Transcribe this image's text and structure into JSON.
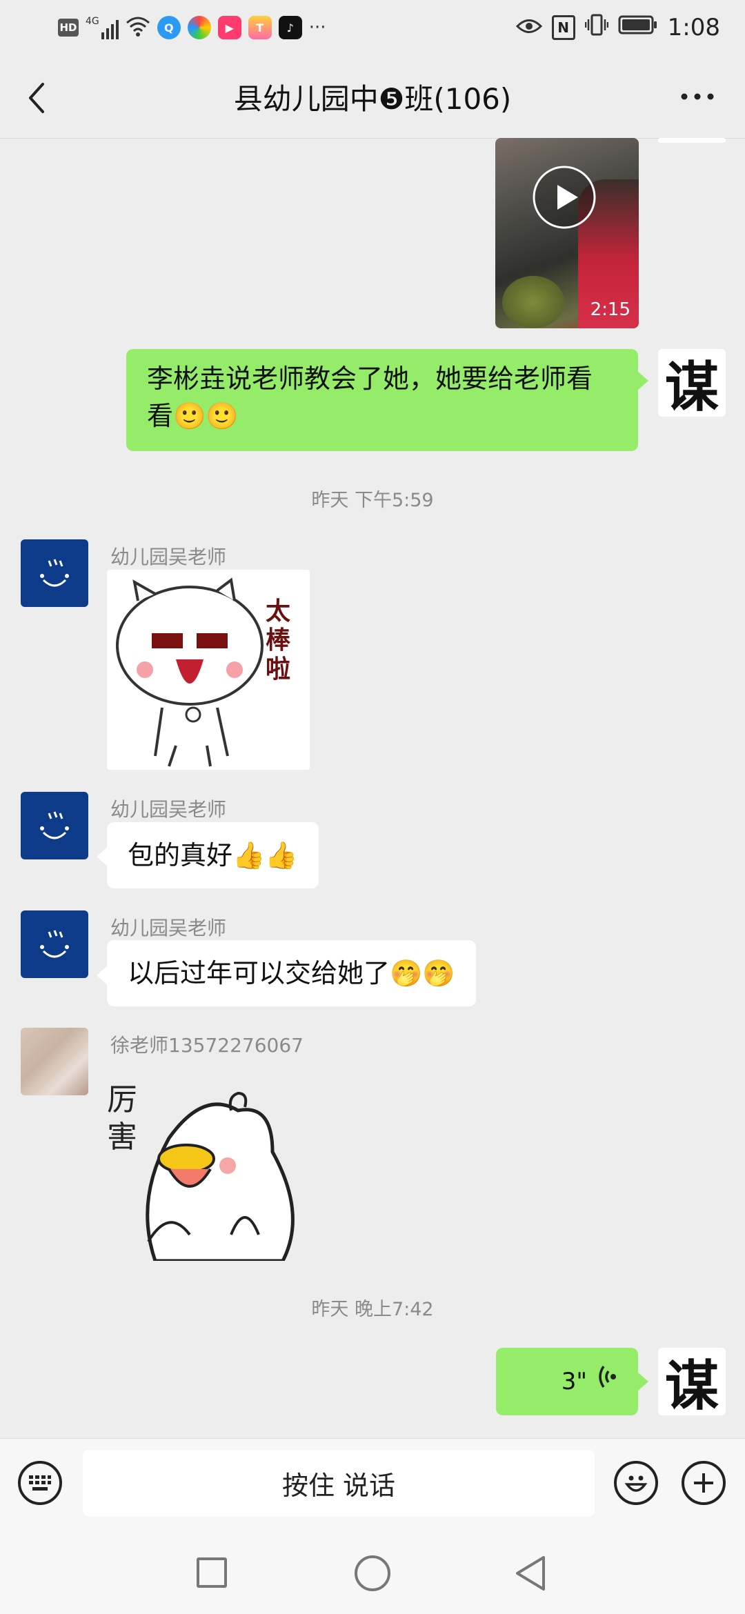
{
  "status_bar": {
    "left_labels": [
      "HD",
      "4G"
    ],
    "more": "···",
    "time": "1:08",
    "icons": [
      "hd-icon",
      "signal-icon",
      "wifi-icon",
      "app-icon-1",
      "app-icon-2",
      "app-icon-3",
      "app-icon-4",
      "tiktok-icon",
      "eye-icon",
      "nfc-icon",
      "vibrate-icon",
      "battery-icon"
    ]
  },
  "header": {
    "title": "县幼儿园中❺班(106)",
    "back_icon": "back-icon",
    "more_icon": "more-icon"
  },
  "messages": {
    "video": {
      "duration": "2:15"
    },
    "msg1": {
      "text": "李彬垚说老师教会了她，她要给老师看看🙂🙂"
    },
    "time1": "昨天 下午5:59",
    "msg2": {
      "sender": "幼儿园吴老师",
      "sticker_text": "太棒啦"
    },
    "msg3": {
      "sender": "幼儿园吴老师",
      "text": "包的真好👍👍"
    },
    "msg4": {
      "sender": "幼儿园吴老师",
      "text": "以后过年可以交给她了🤭🤭"
    },
    "msg5": {
      "sender": "徐老师13572276067",
      "sticker_text": "厉害"
    },
    "time2": "昨天 晚上7:42",
    "voice": {
      "duration": "3\""
    },
    "my_avatar_char": "谋"
  },
  "input": {
    "hold_to_talk": "按住 说话",
    "icons": [
      "keyboard-icon",
      "emoji-icon",
      "plus-icon"
    ]
  },
  "colors": {
    "bubble_me": "#95ec69",
    "bubble_them": "#ffffff",
    "background": "#ededed",
    "avatar_blue": "#0e3a8a"
  }
}
